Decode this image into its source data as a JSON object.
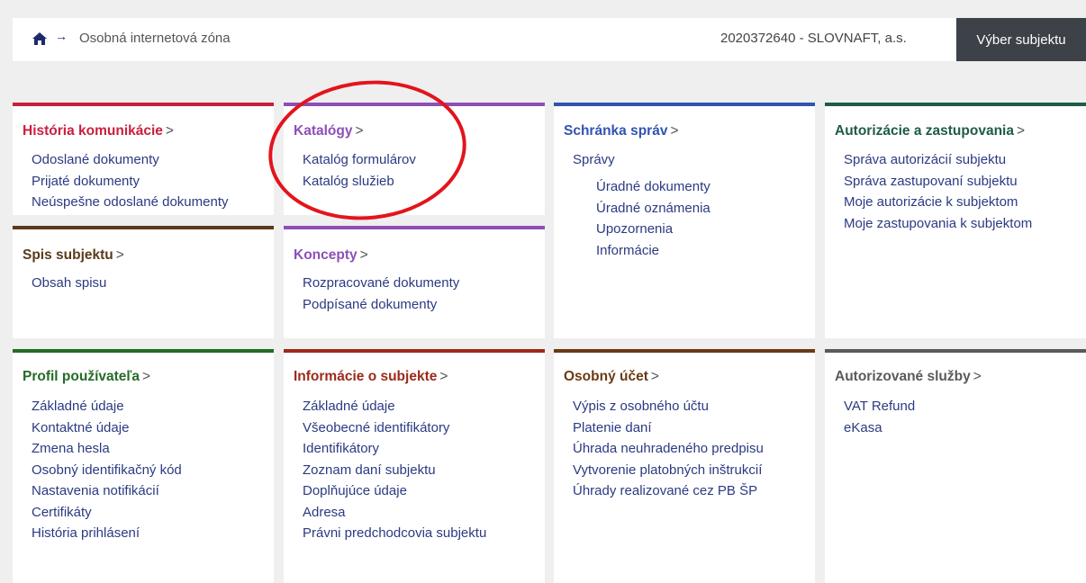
{
  "header": {
    "breadcrumb_arrow": "→",
    "breadcrumb": "Osobná internetová zóna",
    "subject": "2020372640 - SLOVNAFT, a.s.",
    "select_button": "Výber subjektu"
  },
  "cards": {
    "historia": {
      "title": "História komunikácie",
      "color": "#c8203f",
      "links": [
        "Odoslané dokumenty",
        "Prijaté dokumenty",
        "Neúspešne odoslané dokumenty"
      ]
    },
    "katalogy": {
      "title": "Katalógy",
      "color": "#8d4fb6",
      "links": [
        "Katalóg formulárov",
        "Katalóg služieb"
      ]
    },
    "schranka": {
      "title": "Schránka správ",
      "color": "#3253b0",
      "links": [
        "Správy"
      ],
      "sub_links": [
        "Úradné dokumenty",
        "Úradné oznámenia",
        "Upozornenia",
        "Informácie"
      ]
    },
    "autorizacie": {
      "title": "Autorizácie a zastupovania",
      "color": "#1f5c45",
      "links": [
        "Správa autorizácií subjektu",
        "Správa zastupovaní subjektu",
        "Moje autorizácie k subjektom",
        "Moje zastupovania k subjektom"
      ]
    },
    "spis": {
      "title": "Spis subjektu",
      "color": "#5a3a1a",
      "links": [
        "Obsah spisu"
      ]
    },
    "koncepty": {
      "title": "Koncepty",
      "color": "#8d4fb6",
      "links": [
        "Rozpracované dokumenty",
        "Podpísané dokumenty"
      ]
    },
    "profil": {
      "title": "Profil používateľa",
      "color": "#246b27",
      "links": [
        "Základné údaje",
        "Kontaktné údaje",
        "Zmena hesla",
        "Osobný identifikačný kód",
        "Nastavenia notifikácií",
        "Certifikáty",
        "História prihlásení"
      ]
    },
    "informacie": {
      "title": "Informácie o subjekte",
      "color": "#9b2a19",
      "links": [
        "Základné údaje",
        "Všeobecné identifikátory",
        "Identifikátory",
        "Zoznam daní subjektu",
        "Doplňujúce údaje",
        "Adresa",
        "Právni predchodcovia subjektu"
      ]
    },
    "ucet": {
      "title": "Osobný účet",
      "color": "#6b3a14",
      "links": [
        "Výpis z osobného účtu",
        "Platenie daní",
        "Úhrada neuhradeného predpisu",
        "Vytvorenie platobných inštrukcií",
        "Úhrady realizované cez PB ŠP"
      ]
    },
    "autorizovane": {
      "title": "Autorizované služby",
      "color": "#5a5a5a",
      "links": [
        "VAT Refund",
        "eKasa"
      ]
    }
  },
  "gt_symbol": ">",
  "highlight_color": "#e3141b"
}
